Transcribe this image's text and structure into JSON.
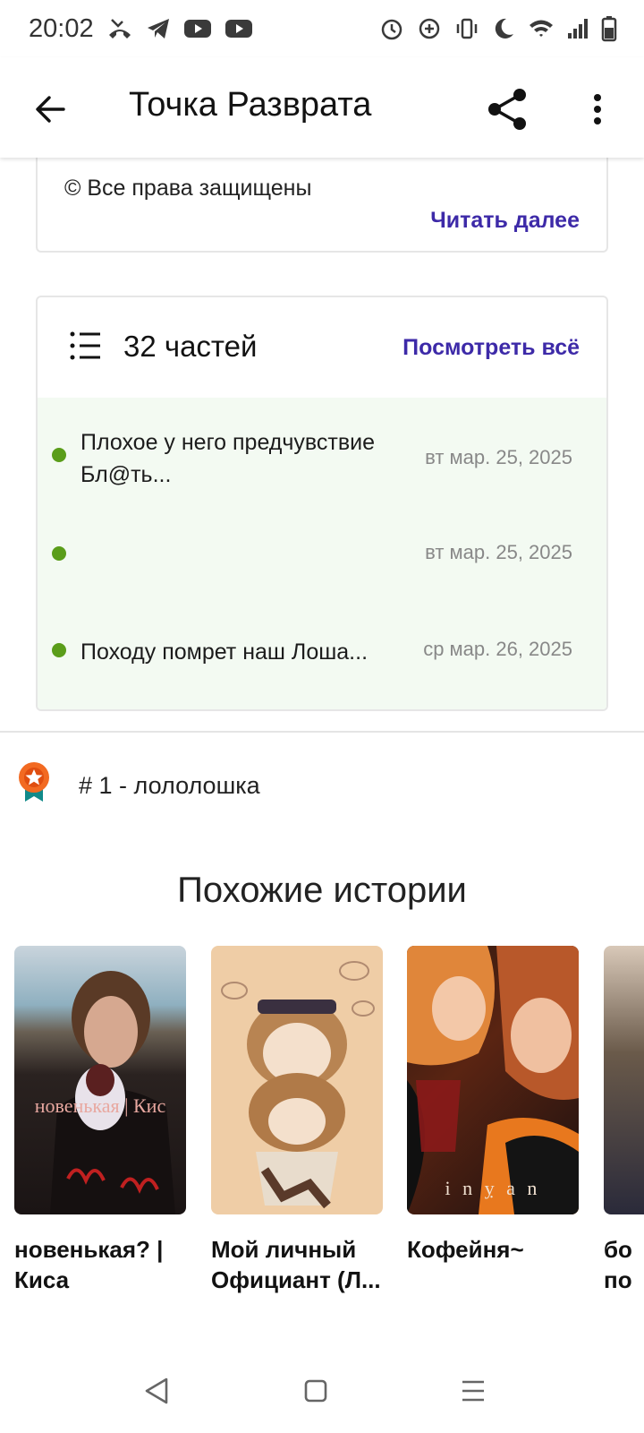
{
  "status_bar": {
    "time": "20:02",
    "left_icons": [
      "missed-call-icon",
      "telegram-icon",
      "youtube-icon",
      "youtube-icon"
    ],
    "right_icons": [
      "alarm-icon",
      "data-saver-icon",
      "vibrate-icon",
      "do-not-disturb-icon",
      "wifi-icon",
      "signal-icon",
      "battery-icon"
    ]
  },
  "app_bar": {
    "title": "Точка Разврата",
    "back_icon": "arrow-left-icon",
    "share_icon": "share-icon",
    "more_icon": "more-vert-icon"
  },
  "description": {
    "copyright": "© Все права защищены",
    "read_more": "Читать далее"
  },
  "parts": {
    "count_label": "32 частей",
    "view_all": "Посмотреть всё",
    "items": [
      {
        "title": "Плохое у него предчувствие Бл@ть...",
        "date": "вт мар. 25, 2025"
      },
      {
        "title": "",
        "date": "вт мар. 25, 2025"
      },
      {
        "title": "Походу помрет наш Лоша...",
        "date": "ср мар. 26, 2025"
      }
    ]
  },
  "ranking": {
    "text": "# 1 - лололошка"
  },
  "similar": {
    "heading": "Похожие истории",
    "stories": [
      {
        "title": "новенькая? | Киса",
        "cover_text": "новенькая | Кис"
      },
      {
        "title": "Мой личный Официант (Л..."
      },
      {
        "title": "Кофейня~",
        "cover_text": "i n  ỵ  a n"
      },
      {
        "title": "бо по"
      }
    ]
  },
  "colors": {
    "accent": "#3d2aa8",
    "dot": "#5a9d1a",
    "parts_bg": "#f3faf2"
  }
}
